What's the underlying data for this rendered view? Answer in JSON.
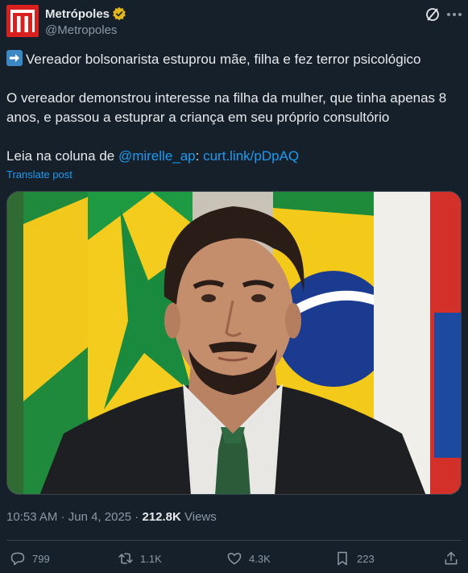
{
  "author": {
    "name": "Metrópoles",
    "handle": "@Metropoles",
    "avatar_color": "#d9201f",
    "verified_badge_color": "#e2b719"
  },
  "post": {
    "line1_emoji": "arrow-right-emoji",
    "line1_text": "Vereador bolsonarista estuprou mãe, filha e fez terror psicológico",
    "paragraph2": "O vereador demonstrou interesse na filha da mulher, que tinha apenas 8 anos, e passou a estuprar a criança em seu próprio consultório",
    "paragraph3_prefix": "Leia na coluna de ",
    "mention": "@mirelle_ap",
    "colon": ": ",
    "url": "curt.link/pDpAQ",
    "translate_label": "Translate post"
  },
  "meta": {
    "time": "10:53 AM",
    "separator": " · ",
    "date": "Jun 4, 2025",
    "separator2": " · ",
    "views_count": "212.8K",
    "views_label": " Views"
  },
  "actions": {
    "replies": "799",
    "reposts": "1.1K",
    "likes": "4.3K",
    "bookmarks": "223"
  },
  "colors": {
    "background": "#15202b",
    "text": "#e7e9ea",
    "secondary": "#8b98a5",
    "link": "#1d9bf0",
    "border": "#38444d"
  }
}
